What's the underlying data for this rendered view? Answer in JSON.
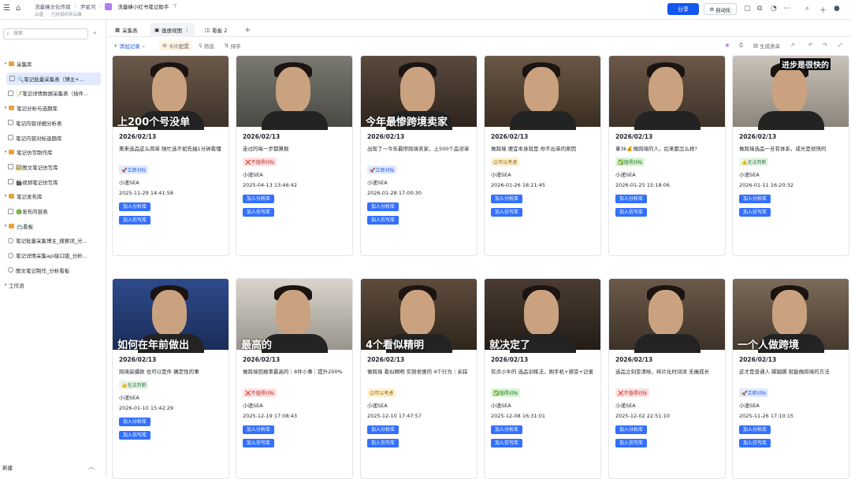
{
  "topbar": {
    "crumbs": [
      "流量蜂文化传媒",
      "尹星河"
    ],
    "doc_title": "流量蜂小红书笔记助手",
    "sub_left": "云盘",
    "sub_right": "已经保存到云端",
    "share_label": "分享",
    "auto_label": "自动化"
  },
  "sidebar": {
    "search_placeholder": "搜索",
    "items": [
      {
        "label": "采集库",
        "type": "folder",
        "level": 0
      },
      {
        "label": "🔍笔记批量采集表（博主+...",
        "type": "table",
        "level": 1,
        "active": true
      },
      {
        "label": "📝笔记详情数据采集表（插件...",
        "type": "table",
        "level": 1
      },
      {
        "label": "笔记分析与选题库",
        "type": "folder",
        "level": 0
      },
      {
        "label": "笔记内容详细分析表",
        "type": "table",
        "level": 1
      },
      {
        "label": "笔记内容对标选题库",
        "type": "table",
        "level": 1
      },
      {
        "label": "笔记仿写制作库",
        "type": "folder",
        "level": 0
      },
      {
        "label": "🖼️图文笔记仿写库",
        "type": "table",
        "level": 1
      },
      {
        "label": "🎬视频笔记仿写库",
        "type": "table",
        "level": 1
      },
      {
        "label": "笔记发布库",
        "type": "folder",
        "level": 0
      },
      {
        "label": "🟢发布内容表",
        "type": "table",
        "level": 1
      },
      {
        "label": "📇看板",
        "type": "folder",
        "level": 0
      },
      {
        "label": "笔记批量采集博主_搜索词_分...",
        "type": "dash",
        "level": 1
      },
      {
        "label": "笔记详情采集api接口版_分析...",
        "type": "dash",
        "level": 1
      },
      {
        "label": "图文笔记制作_分析看板",
        "type": "dash",
        "level": 1
      },
      {
        "label": "工作流",
        "type": "section",
        "level": 0
      }
    ],
    "new_label": "新建"
  },
  "tabs": [
    {
      "label": "采集表",
      "active": false
    },
    {
      "label": "画册视图",
      "active": true
    },
    {
      "label": "看板 2",
      "active": false
    }
  ],
  "toolbar": {
    "add_label": "添加记录",
    "card_config_label": "卡片配置",
    "filter_label": "筛选",
    "sort_label": "排序",
    "gen_form_label": "生成表单"
  },
  "cards": [
    {
      "overlay": "上200个号没单",
      "date": "2026/02/13",
      "title": "熏来选品这么简单 随忙选不如先抽1分钟看懂",
      "badge": "🚀立即对标",
      "badge_type": "go",
      "author": "小递SEA",
      "time": "2025-11-29 14:41:58",
      "btn1": "加入分析库",
      "btn2": "加入仿写库"
    },
    {
      "overlay": "",
      "date": "2026/02/13",
      "title": "走过的每一步都算数",
      "badge": "❌不值得对标",
      "badge_type": "no",
      "author": "小递SEA",
      "time": "2025-04-13 13:46:42",
      "btn1": "加入分析库",
      "btn2": "加入仿写库"
    },
    {
      "overlay": "今年最惨跨境卖家",
      "date": "2026/02/13",
      "title": "出现了～今年最惨跨境卖家，上500个品没单",
      "badge": "🚀立即对标",
      "badge_type": "go",
      "author": "小递SEA",
      "time": "2026-01-28 17:00:30",
      "btn1": "加入分析库",
      "btn2": "加入仿写库"
    },
    {
      "overlay": "",
      "date": "2026/02/13",
      "title": "做跨境 便宜本身就是 你不出单的原因",
      "badge": "😊可以考虑",
      "badge_type": "maybe",
      "author": "小递SEA",
      "time": "2026-01-26 18:21:45",
      "btn1": "加入分析库",
      "btn2": "加入仿写库"
    },
    {
      "overlay": "",
      "date": "2026/02/13",
      "title": "拿3k💰做跨境的人，后来都怎么样?",
      "badge": "✅值得对标",
      "badge_type": "ok",
      "author": "小递SEA",
      "time": "2026-01-25 15:18:06",
      "btn1": "加入分析库",
      "btn2": "加入仿写库"
    },
    {
      "overlay": "进步是很快的",
      "date": "2026/02/13",
      "title": "做跨境选品一旦有体系，成长是很快的",
      "badge": "👍无法判断",
      "badge_type": "unk",
      "author": "小递SEA",
      "time": "2026-01-11 16:20:32",
      "btn1": "加入分析库",
      "btn2": "加入仿写库"
    },
    {
      "overlay": "如何在年前做出",
      "date": "2026/02/13",
      "title": "跨境装爆款 也可以是件 确定性的事",
      "badge": "👍无法判断",
      "badge_type": "unk",
      "author": "小递SEA",
      "time": "2026-01-10 15:42:29",
      "btn1": "加入分析库",
      "btn2": "加入仿写库"
    },
    {
      "overlay": "最高的",
      "date": "2026/02/13",
      "title": "做跨境回报率最高的｜8件小事｜提升200%",
      "badge": "❌不值得对标",
      "badge_type": "no",
      "author": "小递SEA",
      "time": "2025-12-19 17:08:43",
      "btn1": "加入分析库",
      "btn2": "加入仿写库"
    },
    {
      "overlay": "4个看似精明",
      "date": "2026/02/13",
      "title": "做跨境 看似精明 实则很傻的 4个行为｜亲踩",
      "badge": "😊可以考虑",
      "badge_type": "maybe",
      "author": "小递SEA",
      "time": "2025-12-10 17:47:57",
      "btn1": "加入分析库",
      "btn2": "加入仿写库"
    },
    {
      "overlay": "就决定了",
      "date": "2026/02/13",
      "title": "有点小牛的 选品训练法，刷手机+感受+记录",
      "badge": "✅值得对标",
      "badge_type": "ok",
      "author": "小递SEA",
      "time": "2025-12-08 16:31:01",
      "btn1": "加入分析库",
      "btn2": "加入仿写库"
    },
    {
      "overlay": "",
      "date": "2026/02/13",
      "title": "选品立刻变清晰，碎片化时间读 无痛成长",
      "badge": "❌不值得对标",
      "badge_type": "no",
      "author": "小递SEA",
      "time": "2025-12-02 22:51:10",
      "btn1": "加入分析库",
      "btn2": "加入仿写库"
    },
    {
      "overlay": "一个人做跨境",
      "date": "2026/02/13",
      "title": "这才是普通人 脚踏脚 就能做跨境的方法",
      "badge": "🚀立即对标",
      "badge_type": "go",
      "author": "小递SEA",
      "time": "2025-11-26 17:10:15",
      "btn1": "加入分析库",
      "btn2": "加入仿写库"
    }
  ],
  "badge_colors": {
    "go": {
      "bg": "#e1eaff",
      "fg": "#245bdb"
    },
    "no": {
      "bg": "#fde2e2",
      "fg": "#c02d2d"
    },
    "maybe": {
      "bg": "#fef1d0",
      "fg": "#8f5f00"
    },
    "ok": {
      "bg": "#d9f5d6",
      "fg": "#237a1e"
    },
    "unk": {
      "bg": "#e8f5e9",
      "fg": "#2b7a3d"
    }
  }
}
